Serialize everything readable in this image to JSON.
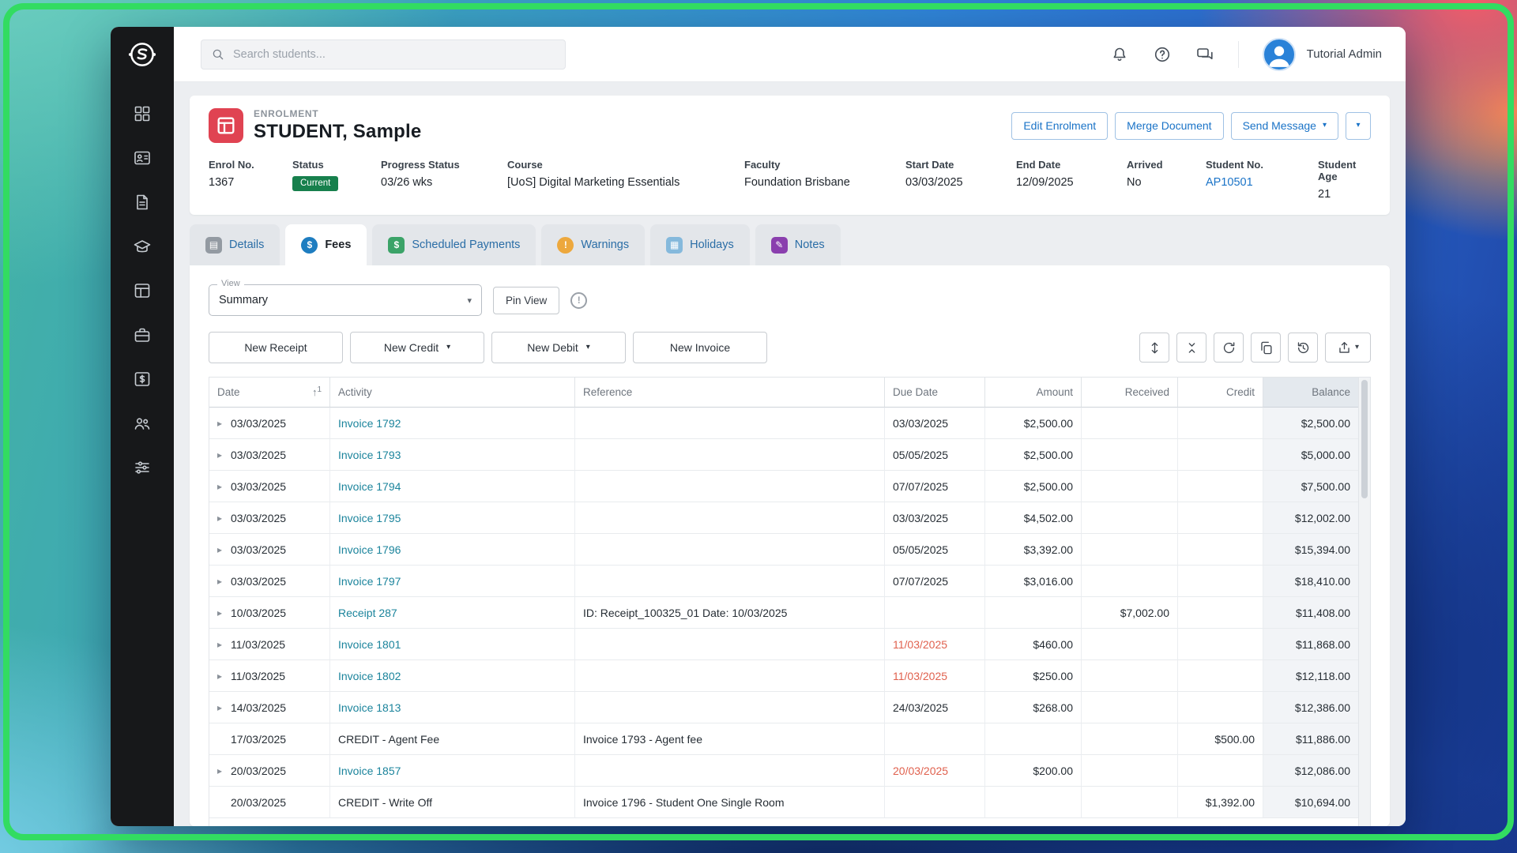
{
  "colors": {
    "frame_green": "#32dc61",
    "accent_blue": "#1a73c7",
    "link_teal": "#1b849c",
    "overdue_red": "#e0614e",
    "status_green": "#17804d",
    "enrol_icon_red": "#e04352"
  },
  "icons": {
    "caret_down": "▾",
    "sort_arrow": "↑",
    "row_expand": "▸",
    "info_circle": "!"
  },
  "sidebar": {
    "items": [
      "app-logo",
      "dashboard-icon",
      "student-contacts-icon",
      "documents-icon",
      "courses-icon",
      "enrolments-icon",
      "agents-icon",
      "finance-icon",
      "staff-icon",
      "settings-icon"
    ]
  },
  "topbar": {
    "search_placeholder": "Search students...",
    "user_name": "Tutorial Admin",
    "icons": [
      "notifications-icon",
      "help-icon",
      "messages-icon"
    ]
  },
  "enrolment_header": {
    "section_label": "ENROLMENT",
    "title": "STUDENT, Sample",
    "action_buttons": [
      {
        "label": "Edit Enrolment",
        "caret": false
      },
      {
        "label": "Merge Document",
        "caret": false
      },
      {
        "label": "Send Message",
        "caret": true
      }
    ],
    "info_fields": [
      {
        "label": "Enrol No.",
        "value": "1367"
      },
      {
        "label": "Status",
        "value": "Current",
        "type": "badge"
      },
      {
        "label": "Progress Status",
        "value": "03/26 wks"
      },
      {
        "label": "Course",
        "value": "[UoS] Digital Marketing Essentials"
      },
      {
        "label": "Faculty",
        "value": "Foundation Brisbane"
      },
      {
        "label": "Start Date",
        "value": "03/03/2025"
      },
      {
        "label": "End Date",
        "value": "12/09/2025"
      },
      {
        "label": "Arrived",
        "value": "No"
      },
      {
        "label": "Student No.",
        "value": "AP10501",
        "type": "link"
      },
      {
        "label": "Student Age",
        "value": "21"
      }
    ]
  },
  "tabs": [
    {
      "label": "Details",
      "glyph": "▤",
      "shape": "square",
      "color": "#939aa2",
      "active": false
    },
    {
      "label": "Fees",
      "glyph": "$",
      "shape": "circle",
      "color": "#1e7dc0",
      "active": true
    },
    {
      "label": "Scheduled Payments",
      "glyph": "$",
      "shape": "square",
      "color": "#3ba368",
      "active": false
    },
    {
      "label": "Warnings",
      "glyph": "!",
      "shape": "circle",
      "color": "#eda83d",
      "active": false
    },
    {
      "label": "Holidays",
      "glyph": "▦",
      "shape": "square",
      "color": "#85b9dc",
      "active": false
    },
    {
      "label": "Notes",
      "glyph": "✎",
      "shape": "square",
      "color": "#8a3fae",
      "active": false
    }
  ],
  "toolbar": {
    "view_label": "View",
    "view_value": "Summary",
    "pin_view_label": "Pin View",
    "actions": [
      {
        "label": "New Receipt",
        "caret": false
      },
      {
        "label": "New Credit",
        "caret": true
      },
      {
        "label": "New Debit",
        "caret": true
      },
      {
        "label": "New Invoice",
        "caret": false
      }
    ],
    "icon_buttons": [
      "expand-rows-icon",
      "collapse-rows-icon",
      "refresh-icon",
      "copy-icon",
      "history-icon",
      "export-icon"
    ]
  },
  "table": {
    "columns": [
      "Date",
      "Activity",
      "Reference",
      "Due Date",
      "Amount",
      "Received",
      "Credit",
      "Balance"
    ],
    "sort_number": "1",
    "rows": [
      {
        "expandable": true,
        "date": "03/03/2025",
        "activity": "Invoice 1792",
        "activity_link": true,
        "reference": "",
        "due_date": "03/03/2025",
        "overdue": false,
        "amount": "$2,500.00",
        "received": "",
        "credit": "",
        "balance": "$2,500.00"
      },
      {
        "expandable": true,
        "date": "03/03/2025",
        "activity": "Invoice 1793",
        "activity_link": true,
        "reference": "",
        "due_date": "05/05/2025",
        "overdue": false,
        "amount": "$2,500.00",
        "received": "",
        "credit": "",
        "balance": "$5,000.00"
      },
      {
        "expandable": true,
        "date": "03/03/2025",
        "activity": "Invoice 1794",
        "activity_link": true,
        "reference": "",
        "due_date": "07/07/2025",
        "overdue": false,
        "amount": "$2,500.00",
        "received": "",
        "credit": "",
        "balance": "$7,500.00"
      },
      {
        "expandable": true,
        "date": "03/03/2025",
        "activity": "Invoice 1795",
        "activity_link": true,
        "reference": "",
        "due_date": "03/03/2025",
        "overdue": false,
        "amount": "$4,502.00",
        "received": "",
        "credit": "",
        "balance": "$12,002.00"
      },
      {
        "expandable": true,
        "date": "03/03/2025",
        "activity": "Invoice 1796",
        "activity_link": true,
        "reference": "",
        "due_date": "05/05/2025",
        "overdue": false,
        "amount": "$3,392.00",
        "received": "",
        "credit": "",
        "balance": "$15,394.00"
      },
      {
        "expandable": true,
        "date": "03/03/2025",
        "activity": "Invoice 1797",
        "activity_link": true,
        "reference": "",
        "due_date": "07/07/2025",
        "overdue": false,
        "amount": "$3,016.00",
        "received": "",
        "credit": "",
        "balance": "$18,410.00"
      },
      {
        "expandable": true,
        "date": "10/03/2025",
        "activity": "Receipt 287",
        "activity_link": true,
        "reference": "ID: Receipt_100325_01 Date: 10/03/2025",
        "due_date": "",
        "overdue": false,
        "amount": "",
        "received": "$7,002.00",
        "credit": "",
        "balance": "$11,408.00"
      },
      {
        "expandable": true,
        "date": "11/03/2025",
        "activity": "Invoice 1801",
        "activity_link": true,
        "reference": "",
        "due_date": "11/03/2025",
        "overdue": true,
        "amount": "$460.00",
        "received": "",
        "credit": "",
        "balance": "$11,868.00"
      },
      {
        "expandable": true,
        "date": "11/03/2025",
        "activity": "Invoice 1802",
        "activity_link": true,
        "reference": "",
        "due_date": "11/03/2025",
        "overdue": true,
        "amount": "$250.00",
        "received": "",
        "credit": "",
        "balance": "$12,118.00"
      },
      {
        "expandable": true,
        "date": "14/03/2025",
        "activity": "Invoice 1813",
        "activity_link": true,
        "reference": "",
        "due_date": "24/03/2025",
        "overdue": false,
        "amount": "$268.00",
        "received": "",
        "credit": "",
        "balance": "$12,386.00"
      },
      {
        "expandable": false,
        "date": "17/03/2025",
        "activity": "CREDIT - Agent Fee",
        "activity_link": false,
        "reference": "Invoice 1793 - Agent fee",
        "due_date": "",
        "overdue": false,
        "amount": "",
        "received": "",
        "credit": "$500.00",
        "balance": "$11,886.00"
      },
      {
        "expandable": true,
        "date": "20/03/2025",
        "activity": "Invoice 1857",
        "activity_link": true,
        "reference": "",
        "due_date": "20/03/2025",
        "overdue": true,
        "amount": "$200.00",
        "received": "",
        "credit": "",
        "balance": "$12,086.00"
      },
      {
        "expandable": false,
        "date": "20/03/2025",
        "activity": "CREDIT - Write Off",
        "activity_link": false,
        "reference": "Invoice 1796 - Student One Single Room",
        "due_date": "",
        "overdue": false,
        "amount": "",
        "received": "",
        "credit": "$1,392.00",
        "balance": "$10,694.00"
      }
    ]
  }
}
